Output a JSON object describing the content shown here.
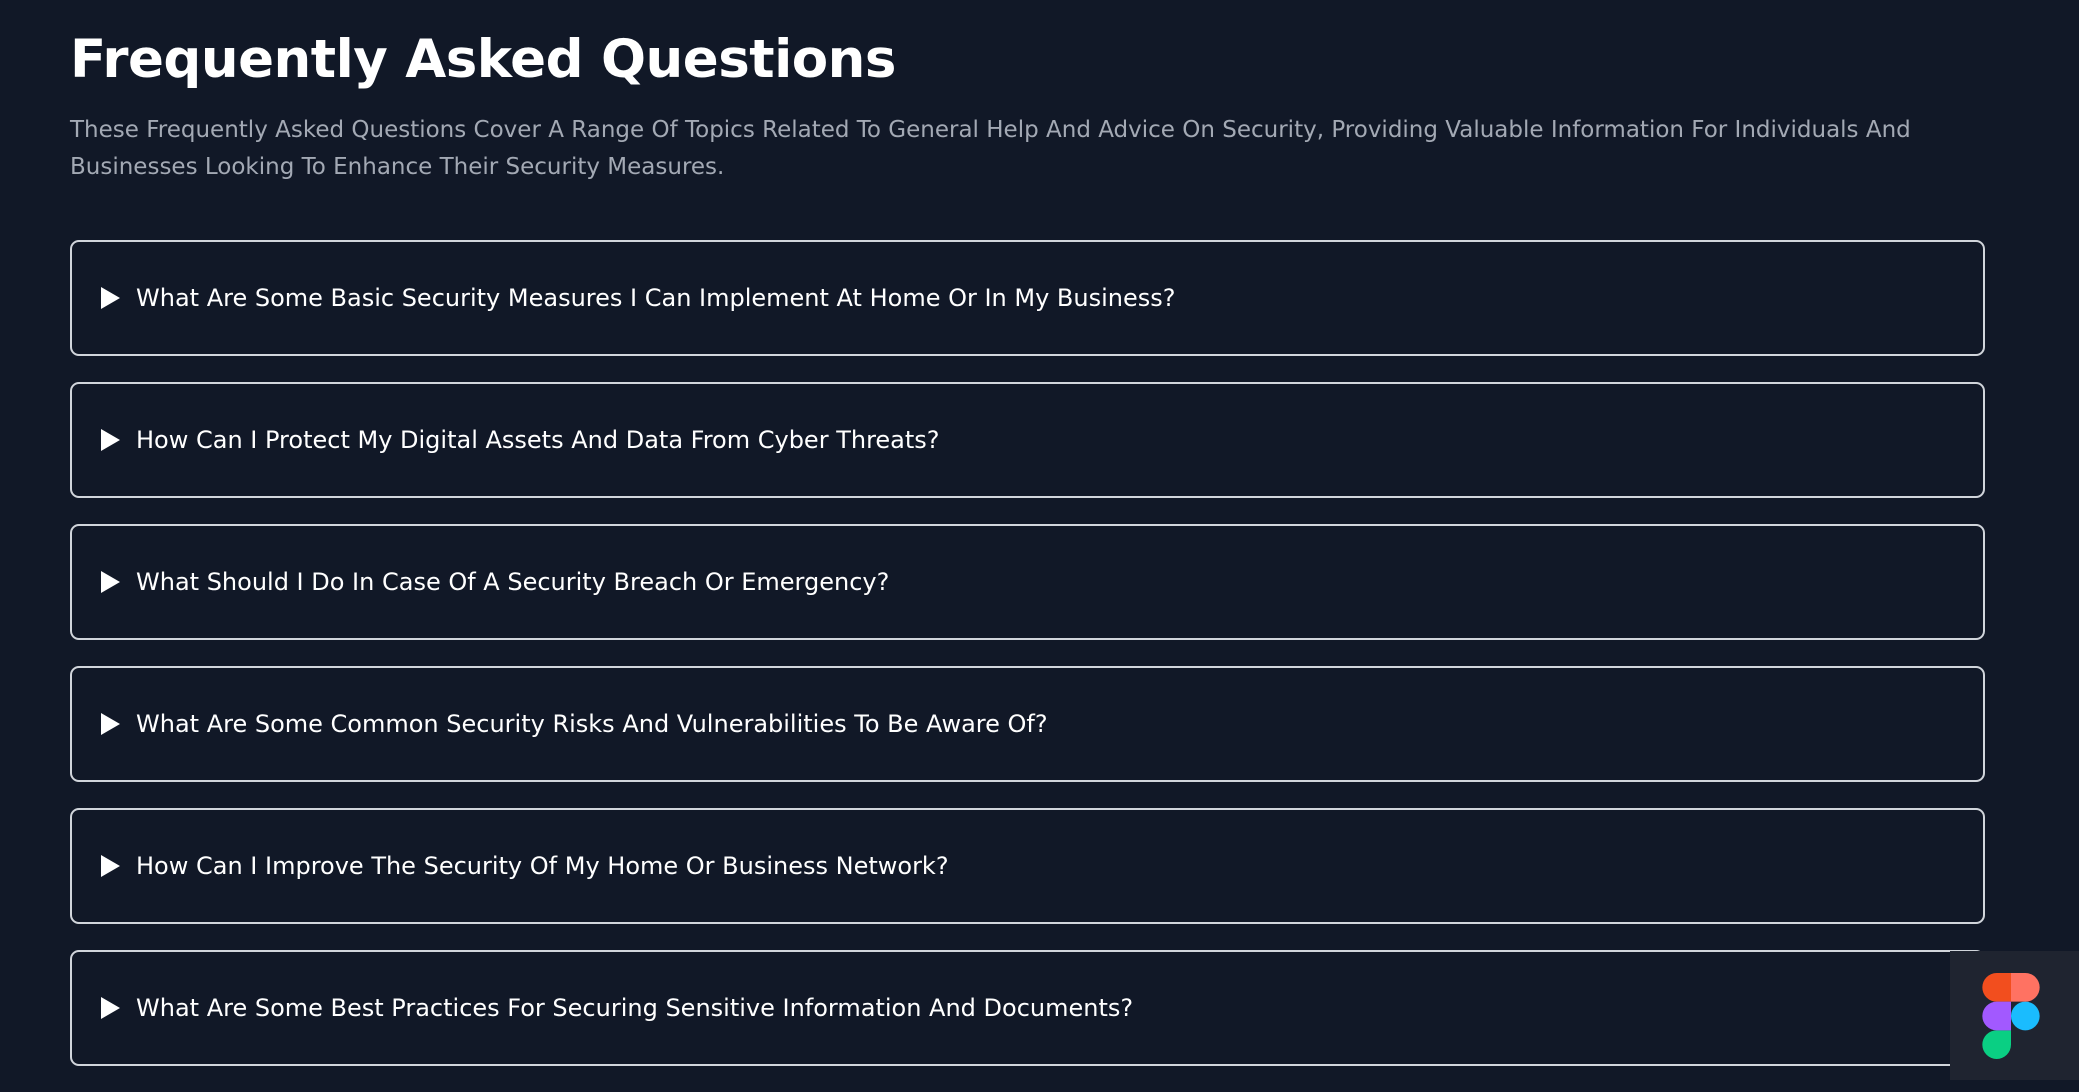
{
  "faq": {
    "title": "Frequently Asked Questions",
    "subtitle": "These Frequently Asked Questions Cover A Range Of Topics Related To General Help And Advice On Security, Providing Valuable Information For Individuals And Businesses Looking To Enhance Their Security Measures.",
    "items": [
      {
        "question": "What Are Some Basic Security Measures I Can Implement At Home Or In My Business?"
      },
      {
        "question": "How Can I Protect My Digital Assets And Data From Cyber Threats?"
      },
      {
        "question": "What Should I Do In Case Of A Security Breach Or Emergency?"
      },
      {
        "question": "What Are Some Common Security Risks And Vulnerabilities To Be Aware Of?"
      },
      {
        "question": "How Can I Improve The Security Of My Home Or Business Network?"
      },
      {
        "question": "What Are Some Best Practices For Securing Sensitive Information And Documents?"
      }
    ]
  },
  "icons": {
    "toggle": "triangle-right-icon",
    "badge": "figma-logo-icon"
  },
  "colors": {
    "background": "#111827",
    "text": "#ffffff",
    "subtitle": "#a3a9b4",
    "border": "#d1d5db",
    "figma_red": "#f24e1e",
    "figma_orange": "#ff7262",
    "figma_purple": "#a259ff",
    "figma_blue": "#1abcfe",
    "figma_green": "#0acf83"
  }
}
